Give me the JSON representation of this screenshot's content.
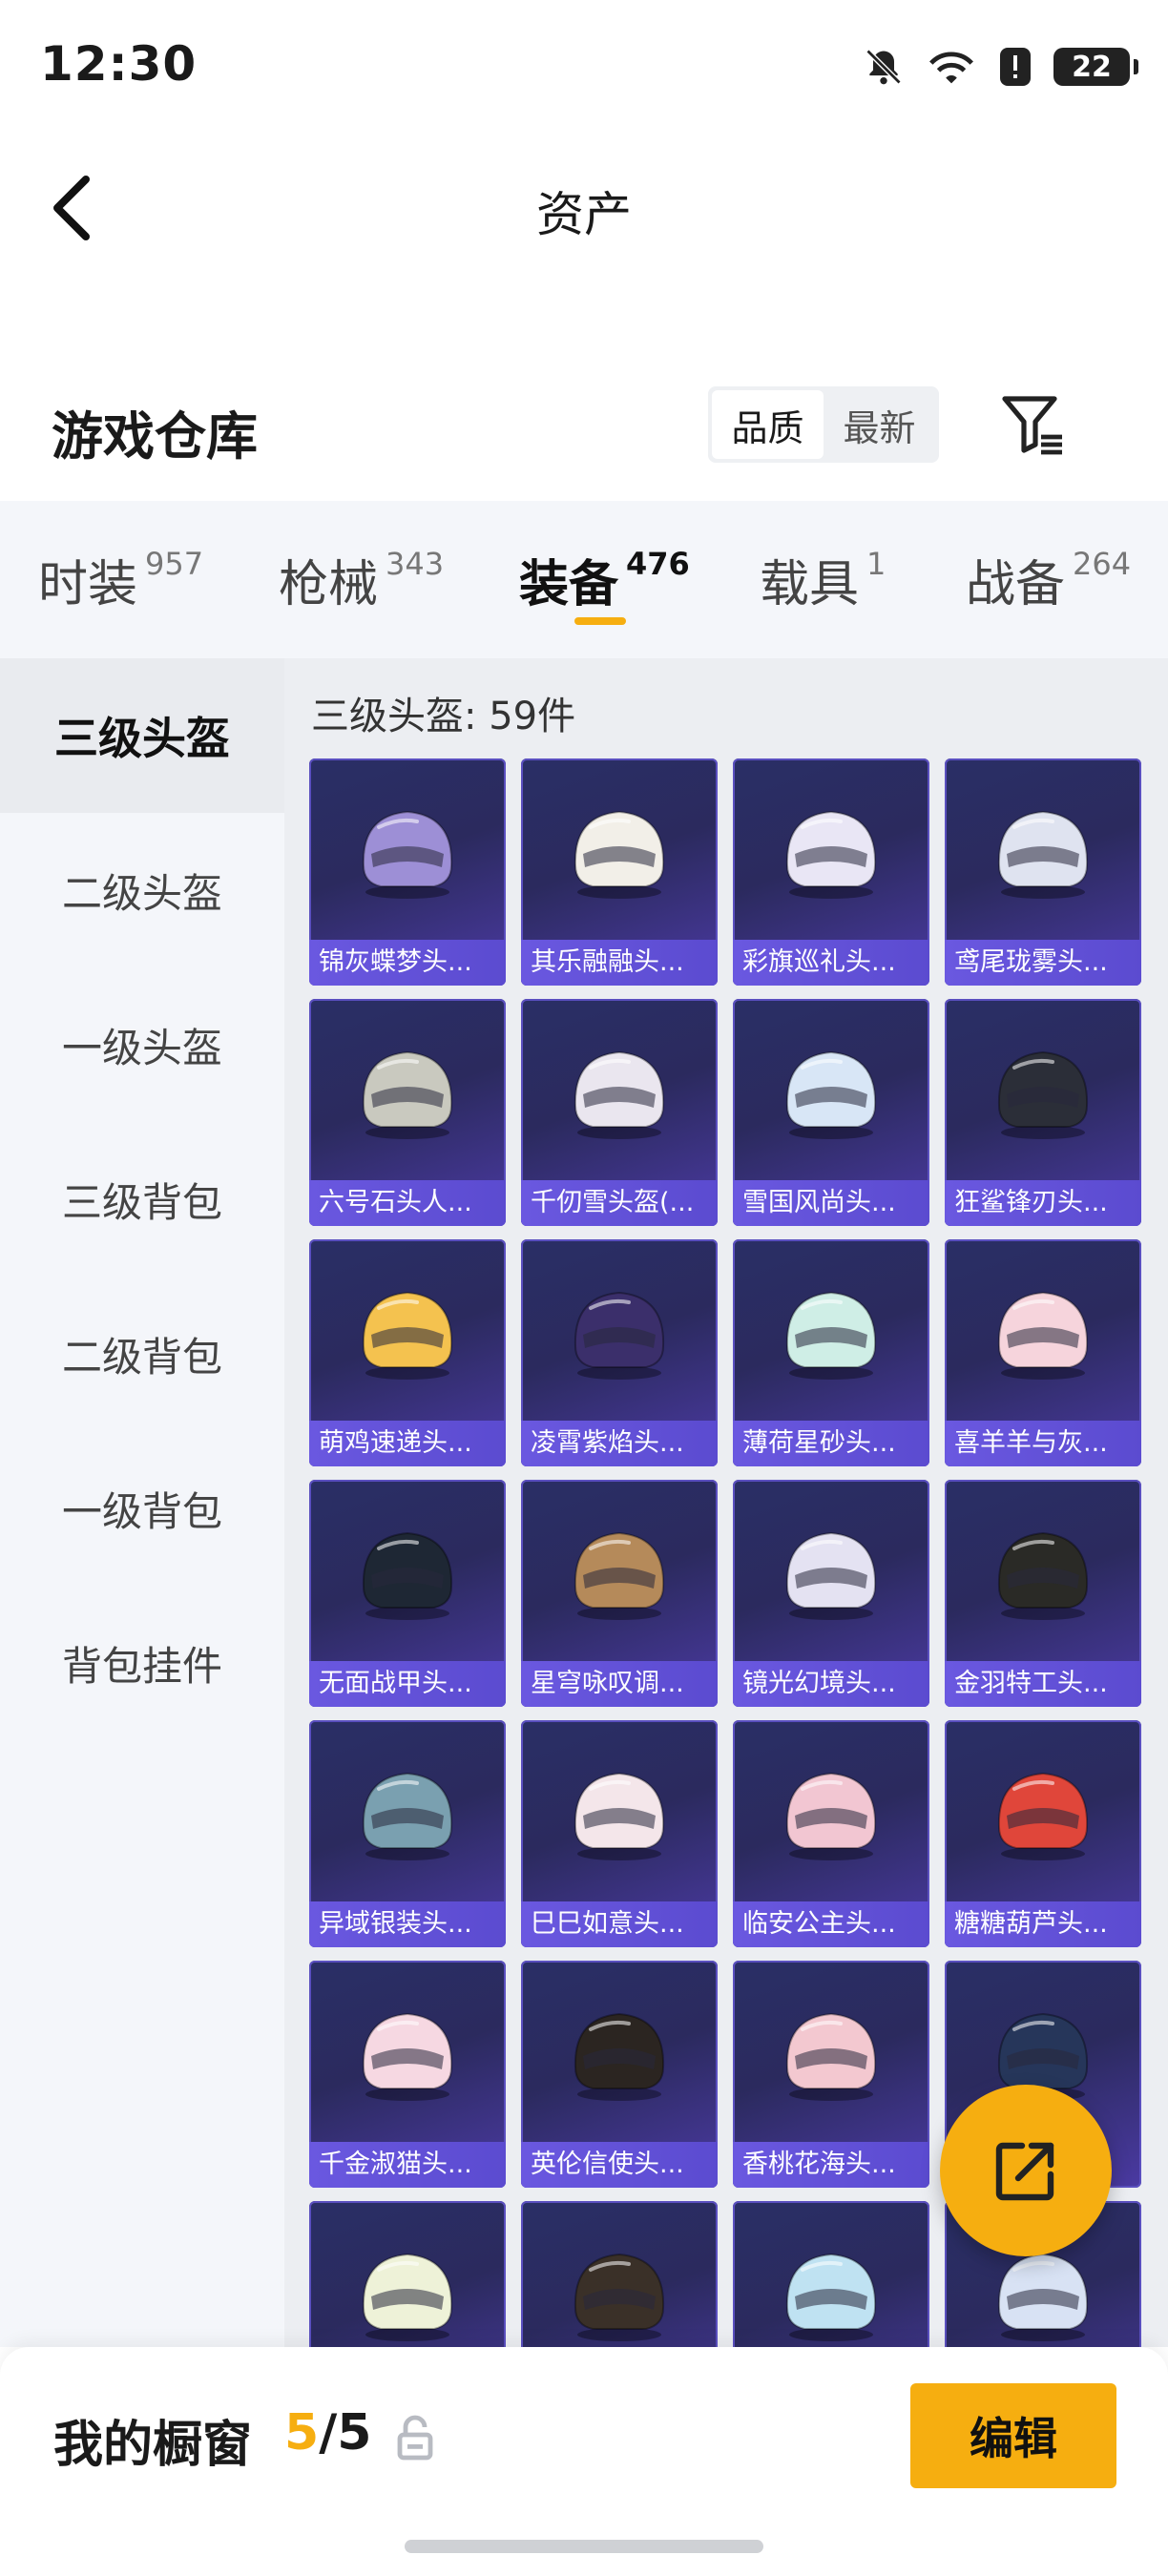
{
  "status_bar": {
    "time": "12:30",
    "battery": "22"
  },
  "nav": {
    "title": "资产"
  },
  "warehouse": {
    "title": "游戏仓库",
    "sort_options": [
      "品质",
      "最新"
    ]
  },
  "tabs": [
    {
      "label": "时装",
      "count": "957"
    },
    {
      "label": "枪械",
      "count": "343"
    },
    {
      "label": "装备",
      "count": "476",
      "active": true
    },
    {
      "label": "载具",
      "count": "1"
    },
    {
      "label": "战备",
      "count": "264"
    }
  ],
  "sidebar": [
    {
      "label": "三级头盔",
      "active": true
    },
    {
      "label": "二级头盔"
    },
    {
      "label": "一级头盔"
    },
    {
      "label": "三级背包"
    },
    {
      "label": "二级背包"
    },
    {
      "label": "一级背包"
    },
    {
      "label": "背包挂件"
    }
  ],
  "section": {
    "title": "三级头盔: 59件"
  },
  "items": [
    {
      "label": "锦灰蝶梦头...",
      "color": "#9d8fd6"
    },
    {
      "label": "其乐融融头...",
      "color": "#f2efe8"
    },
    {
      "label": "彩旗巡礼头...",
      "color": "#e9e6f5"
    },
    {
      "label": "鸢尾珑雾头...",
      "color": "#dfe3f0"
    },
    {
      "label": "六号石头人...",
      "color": "#c9c9bf"
    },
    {
      "label": "千仞雪头盔(...",
      "color": "#eae6ef"
    },
    {
      "label": "雪国风尚头...",
      "color": "#d8e6f6"
    },
    {
      "label": "狂鲨锋刃头...",
      "color": "#2b2e38"
    },
    {
      "label": "萌鸡速递头...",
      "color": "#f4c24f"
    },
    {
      "label": "凌霄紫焰头...",
      "color": "#3b2f6b"
    },
    {
      "label": "薄荷星砂头...",
      "color": "#cfeee6"
    },
    {
      "label": "喜羊羊与灰...",
      "color": "#f6d4dc"
    },
    {
      "label": "无面战甲头...",
      "color": "#1e2734"
    },
    {
      "label": "星穹咏叹调...",
      "color": "#b58a5a"
    },
    {
      "label": "镜光幻境头...",
      "color": "#e4e2f2"
    },
    {
      "label": "金羽特工头...",
      "color": "#2a2a26"
    },
    {
      "label": "异域银装头...",
      "color": "#7aa0b0"
    },
    {
      "label": "巳巳如意头...",
      "color": "#f4e6ea"
    },
    {
      "label": "临安公主头...",
      "color": "#f2c6d2"
    },
    {
      "label": "糖糖葫芦头...",
      "color": "#e0463a"
    },
    {
      "label": "千金淑猫头...",
      "color": "#f6d8e2"
    },
    {
      "label": "英伦信使头...",
      "color": "#2b2521"
    },
    {
      "label": "香桃花海头...",
      "color": "#f3c8d0"
    },
    {
      "label": "",
      "color": "#26365a"
    },
    {
      "label": "",
      "color": "#eef2d8"
    },
    {
      "label": "",
      "color": "#3a3028"
    },
    {
      "label": "",
      "color": "#bfe2f2"
    },
    {
      "label": "",
      "color": "#d8e2f4"
    }
  ],
  "bottom": {
    "label": "我的橱窗",
    "count_used": "5",
    "count_sep": "/",
    "count_total": "5",
    "edit": "编辑"
  },
  "colors": {
    "accent": "#f6ae10"
  }
}
